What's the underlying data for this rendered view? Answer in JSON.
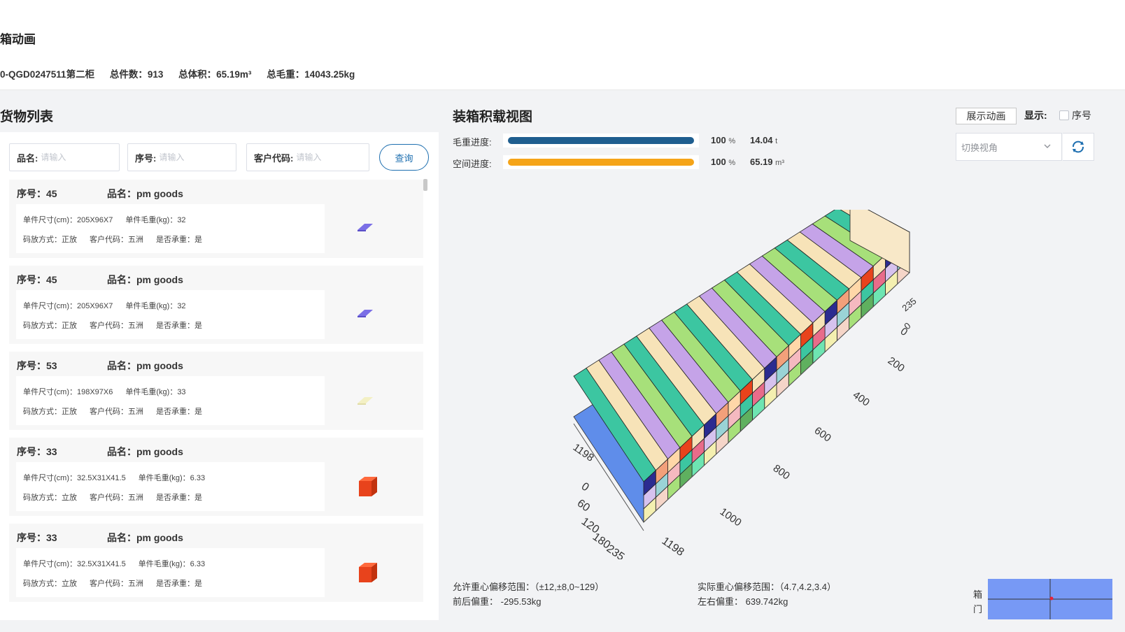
{
  "header": {
    "title": "箱动画",
    "container_id": "0-QGD0247511第二柜",
    "total_count": "总件数：913",
    "total_volume": "总体积：65.19m³",
    "total_weight": "总毛重：14043.25kg"
  },
  "cargo_list": {
    "title": "货物列表",
    "filters": [
      {
        "label": "品名:",
        "placeholder": "请输入",
        "value": ""
      },
      {
        "label": "序号:",
        "placeholder": "请输入",
        "value": ""
      },
      {
        "label": "客户代码:",
        "placeholder": "请输入",
        "value": ""
      }
    ],
    "query_label": "查询",
    "items": [
      {
        "seq": "序号：45",
        "name": "品名：pm goods",
        "size": "单件尺寸(cm)：205X96X7",
        "weight": "单件毛重(kg)：32",
        "placement": "码放方式：正放",
        "customer": "客户代码：五洲",
        "bearing": "是否承重：是",
        "icon": "flat-slab-icon",
        "color": "#7b6fe6"
      },
      {
        "seq": "序号：45",
        "name": "品名：pm goods",
        "size": "单件尺寸(cm)：205X96X7",
        "weight": "单件毛重(kg)：32",
        "placement": "码放方式：正放",
        "customer": "客户代码：五洲",
        "bearing": "是否承重：是",
        "icon": "flat-slab-icon",
        "color": "#7b6fe6"
      },
      {
        "seq": "序号：53",
        "name": "品名：pm goods",
        "size": "单件尺寸(cm)：198X97X6",
        "weight": "单件毛重(kg)：33",
        "placement": "码放方式：正放",
        "customer": "客户代码：五洲",
        "bearing": "是否承重：是",
        "icon": "flat-slab-icon",
        "color": "#f3f0c4"
      },
      {
        "seq": "序号：33",
        "name": "品名：pm goods",
        "size": "单件尺寸(cm)：32.5X31X41.5",
        "weight": "单件毛重(kg)：6.33",
        "placement": "码放方式：立放",
        "customer": "客户代码：五洲",
        "bearing": "是否承重：是",
        "icon": "cube-box-icon",
        "color": "#e8431c"
      },
      {
        "seq": "序号：33",
        "name": "品名：pm goods",
        "size": "单件尺寸(cm)：32.5X31X41.5",
        "weight": "单件毛重(kg)：6.33",
        "placement": "码放方式：立放",
        "customer": "客户代码：五洲",
        "bearing": "是否承重：是",
        "icon": "cube-box-icon",
        "color": "#e8431c"
      }
    ]
  },
  "load_view": {
    "title": "装箱积载视图",
    "animate_label": "展示动画",
    "display_label": "显示:",
    "seq_option": "序号",
    "seq_checked": false,
    "view_select": "切换视角",
    "weight_progress": {
      "label": "毛重进度:",
      "percent": 100,
      "percent_text": "100",
      "percent_unit": "%",
      "value": "14.04",
      "unit": "t",
      "color": "#1f5e8f"
    },
    "space_progress": {
      "label": "空间进度:",
      "percent": 100,
      "percent_text": "100",
      "percent_unit": "%",
      "value": "65.19",
      "unit": "m³",
      "color": "#f5a418"
    },
    "axis_length_ticks": [
      "0",
      "200",
      "400",
      "600",
      "800",
      "1000",
      "1198"
    ],
    "axis_width_ticks": [
      "0",
      "60",
      "120",
      "180",
      "235"
    ],
    "axis_height_ticks": [
      "0",
      "235",
      "1198"
    ],
    "allowed_cg": "允许重心偏移范围：（±12,±8,0~129）",
    "actual_cg": "实际重心偏移范围：（4.7,4.2,3.4）",
    "front_back": "前后偏重：   -295.53kg",
    "left_right": "左右偏重：   639.742kg",
    "door_label_1": "箱",
    "door_label_2": "门",
    "colors": {
      "accent": "#1e6fb0",
      "floor": "#5f8dea",
      "door_map": "#7799f5",
      "cg_marker": "#e8233a"
    }
  }
}
